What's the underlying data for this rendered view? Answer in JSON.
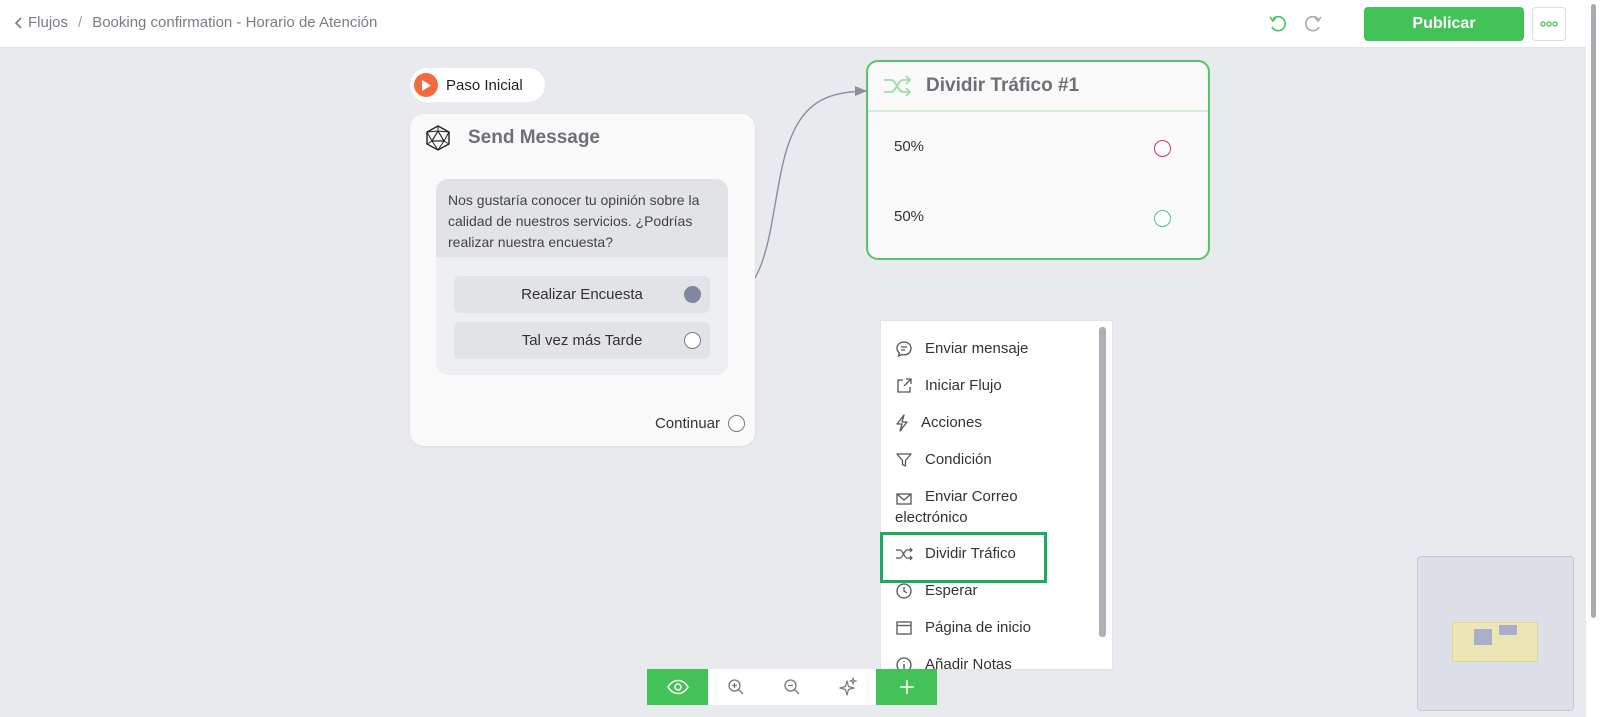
{
  "header": {
    "back_label": "Flujos",
    "separator": "/",
    "flow_title": "Booking confirmation - Horario de Atención",
    "publish_label": "Publicar"
  },
  "start": {
    "label": "Paso Inicial"
  },
  "send_node": {
    "title": "Send Message",
    "message": "Nos gustaría conocer tu opinión sobre la calidad de nuestros servicios. ¿Podrías realizar nuestra encuesta?",
    "choices": [
      {
        "label": "Realizar Encuesta"
      },
      {
        "label": "Tal vez más Tarde"
      }
    ],
    "continue_label": "Continuar"
  },
  "split_node": {
    "title": "Dividir Tráfico #1",
    "branches": [
      {
        "label": "50%",
        "color": "#d8315b"
      },
      {
        "label": "50%",
        "color": "#4bbfa4"
      }
    ]
  },
  "menu": {
    "items": [
      {
        "label": "Enviar mensaje",
        "icon": "chat-icon"
      },
      {
        "label": "Iniciar Flujo",
        "icon": "external-link-icon"
      },
      {
        "label": "Acciones",
        "icon": "lightning-icon"
      },
      {
        "label": "Condición",
        "icon": "filter-icon"
      },
      {
        "label": "Enviar Correo electrónico",
        "icon": "mail-icon"
      },
      {
        "label": "Dividir Tráfico",
        "icon": "shuffle-icon"
      },
      {
        "label": "Esperar",
        "icon": "clock-icon"
      },
      {
        "label": "Página de inicio",
        "icon": "window-icon"
      },
      {
        "label": "Añadir Notas",
        "icon": "info-icon"
      }
    ]
  },
  "colors": {
    "accent": "#43c258",
    "highlight": "#1fa862",
    "start": "#f26a3d"
  }
}
